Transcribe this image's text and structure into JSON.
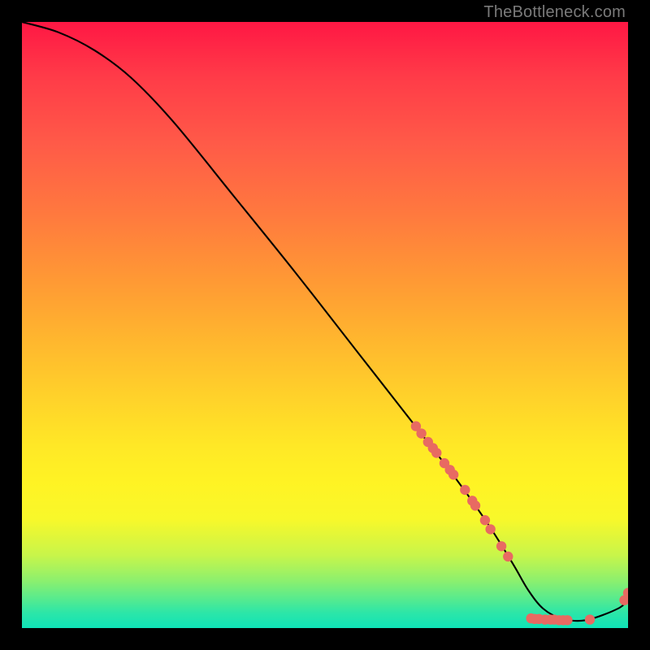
{
  "attribution": "TheBottleneck.com",
  "chart_data": {
    "type": "line",
    "title": "",
    "xlabel": "",
    "ylabel": "",
    "xlim": [
      0,
      100
    ],
    "ylim": [
      0,
      100
    ],
    "series": [
      {
        "name": "curve",
        "x": [
          0,
          6,
          12,
          18,
          25,
          35,
          45,
          55,
          65,
          72,
          77,
          81,
          83.5,
          86,
          89,
          93,
          98.5,
          100
        ],
        "y": [
          100,
          98.3,
          95.3,
          90.8,
          83.5,
          71.2,
          58.8,
          46.0,
          33.2,
          24.1,
          17.0,
          10.6,
          6.3,
          3.2,
          1.6,
          1.3,
          3.3,
          5.0
        ]
      }
    ],
    "scatter_points": [
      {
        "x": 65.0,
        "y": 33.3
      },
      {
        "x": 65.9,
        "y": 32.1
      },
      {
        "x": 67.0,
        "y": 30.7
      },
      {
        "x": 67.8,
        "y": 29.7
      },
      {
        "x": 68.4,
        "y": 28.9
      },
      {
        "x": 69.7,
        "y": 27.2
      },
      {
        "x": 70.6,
        "y": 26.1
      },
      {
        "x": 71.2,
        "y": 25.3
      },
      {
        "x": 73.1,
        "y": 22.8
      },
      {
        "x": 74.3,
        "y": 21.0
      },
      {
        "x": 74.8,
        "y": 20.2
      },
      {
        "x": 76.4,
        "y": 17.8
      },
      {
        "x": 77.3,
        "y": 16.3
      },
      {
        "x": 79.1,
        "y": 13.5
      },
      {
        "x": 80.2,
        "y": 11.8
      },
      {
        "x": 84.0,
        "y": 1.6
      },
      {
        "x": 84.6,
        "y": 1.5
      },
      {
        "x": 85.3,
        "y": 1.5
      },
      {
        "x": 86.3,
        "y": 1.4
      },
      {
        "x": 87.2,
        "y": 1.4
      },
      {
        "x": 87.8,
        "y": 1.4
      },
      {
        "x": 88.6,
        "y": 1.3
      },
      {
        "x": 89.3,
        "y": 1.3
      },
      {
        "x": 90.0,
        "y": 1.3
      },
      {
        "x": 93.7,
        "y": 1.4
      },
      {
        "x": 99.4,
        "y": 4.6
      },
      {
        "x": 100.0,
        "y": 5.8
      }
    ],
    "colors": {
      "curve": "#000000",
      "points": "#e86a62"
    }
  }
}
